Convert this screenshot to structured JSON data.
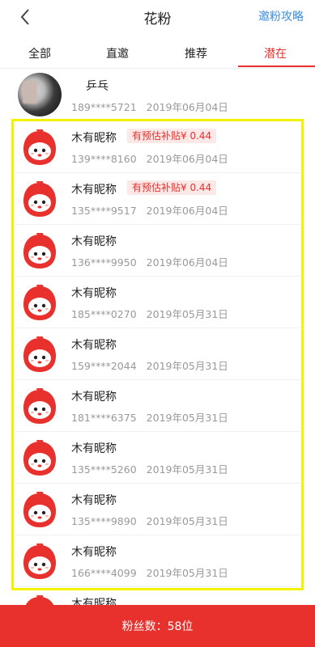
{
  "header": {
    "title": "花粉",
    "invite_label": "邀粉攻略"
  },
  "tabs": [
    {
      "label": "全部"
    },
    {
      "label": "直邀"
    },
    {
      "label": "推荐"
    },
    {
      "label": "潜在"
    }
  ],
  "active_tab": "潜在",
  "fans": [
    {
      "name": "乒乓",
      "phone": "189****5721",
      "date": "2019年06月04日",
      "badge": ""
    },
    {
      "name": "木有昵称",
      "phone": "139****8160",
      "date": "2019年06月04日",
      "badge": "有预估补贴¥ 0.44"
    },
    {
      "name": "木有昵称",
      "phone": "135****9517",
      "date": "2019年06月04日",
      "badge": "有预估补贴¥ 0.44"
    },
    {
      "name": "木有昵称",
      "phone": "136****9950",
      "date": "2019年06月04日",
      "badge": ""
    },
    {
      "name": "木有昵称",
      "phone": "185****0270",
      "date": "2019年05月31日",
      "badge": ""
    },
    {
      "name": "木有昵称",
      "phone": "159****2044",
      "date": "2019年05月31日",
      "badge": ""
    },
    {
      "name": "木有昵称",
      "phone": "181****6375",
      "date": "2019年05月31日",
      "badge": ""
    },
    {
      "name": "木有昵称",
      "phone": "135****5260",
      "date": "2019年05月31日",
      "badge": ""
    },
    {
      "name": "木有昵称",
      "phone": "135****9890",
      "date": "2019年05月31日",
      "badge": ""
    },
    {
      "name": "木有昵称",
      "phone": "166****4099",
      "date": "2019年05月31日",
      "badge": ""
    },
    {
      "name": "木有昵称",
      "phone": "",
      "date": "",
      "badge": ""
    }
  ],
  "footer": {
    "fan_count_label": "粉丝数：58位"
  },
  "colors": {
    "accent": "#e8302c",
    "link": "#3b8fe0",
    "highlight": "#f5f200"
  }
}
